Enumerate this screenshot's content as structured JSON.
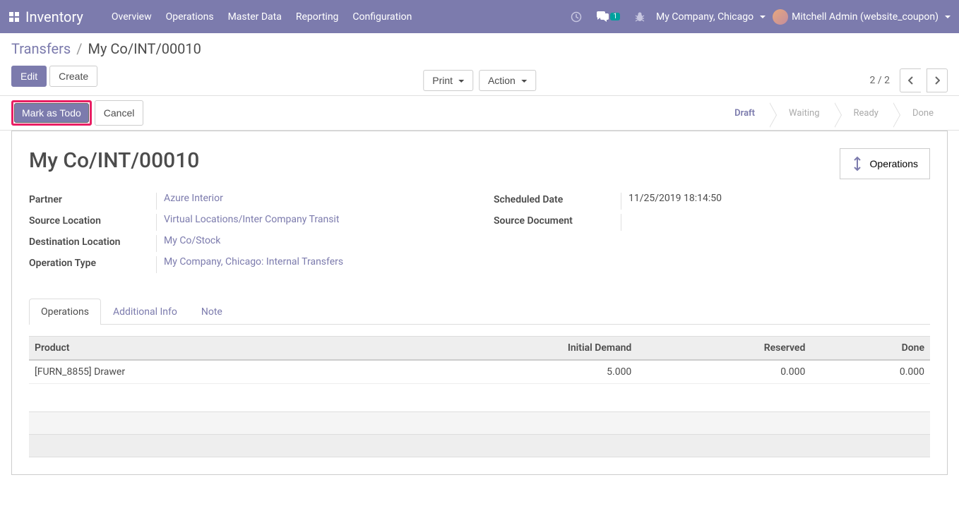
{
  "navbar": {
    "title": "Inventory",
    "menu": [
      "Overview",
      "Operations",
      "Master Data",
      "Reporting",
      "Configuration"
    ],
    "msg_badge": "1",
    "company": "My Company, Chicago",
    "user": "Mitchell Admin (website_coupon)"
  },
  "breadcrumb": {
    "parent": "Transfers",
    "current": "My Co/INT/00010"
  },
  "buttons": {
    "edit": "Edit",
    "create": "Create",
    "print": "Print",
    "action": "Action",
    "mark_todo": "Mark as Todo",
    "cancel": "Cancel",
    "operations": "Operations"
  },
  "pager": "2 / 2",
  "status": {
    "draft": "Draft",
    "waiting": "Waiting",
    "ready": "Ready",
    "done": "Done"
  },
  "record": {
    "title": "My Co/INT/00010",
    "labels": {
      "partner": "Partner",
      "source_location": "Source Location",
      "destination_location": "Destination Location",
      "operation_type": "Operation Type",
      "scheduled_date": "Scheduled Date",
      "source_document": "Source Document"
    },
    "values": {
      "partner": "Azure Interior",
      "source_location": "Virtual Locations/Inter Company Transit",
      "destination_location": "My Co/Stock",
      "operation_type": "My Company, Chicago: Internal Transfers",
      "scheduled_date": "11/25/2019 18:14:50",
      "source_document": ""
    }
  },
  "tabs": {
    "operations": "Operations",
    "additional_info": "Additional Info",
    "note": "Note"
  },
  "table": {
    "headers": {
      "product": "Product",
      "initial_demand": "Initial Demand",
      "reserved": "Reserved",
      "done": "Done"
    },
    "rows": [
      {
        "product": "[FURN_8855] Drawer",
        "initial_demand": "5.000",
        "reserved": "0.000",
        "done": "0.000"
      }
    ]
  }
}
